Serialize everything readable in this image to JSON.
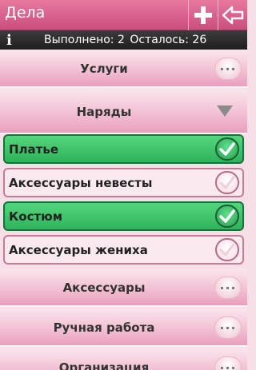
{
  "header": {
    "title": "Дела",
    "add_icon": "plus-icon",
    "back_icon": "back-arrow-icon"
  },
  "status": {
    "info_icon": "info-icon",
    "info_glyph": "i",
    "done_label": "Выполнено: 2",
    "left_label": "Осталось: 26"
  },
  "list": {
    "cat_uslugi": "Услуги",
    "cat_naryady": "Наряды",
    "item_plate": "Платье",
    "item_aks_nevesty": "Аксессуары невесты",
    "item_kostyum": "Костюм",
    "item_aks_zheniha": "Аксессуары жениха",
    "cat_aksessuary": "Аксессуары",
    "cat_ruchnaya": "Ручная работа",
    "cat_organizaciya": "Организация",
    "dots_glyph": "···"
  },
  "colors": {
    "header": "#d9618b",
    "done": "#3cc066",
    "category": "#f2c1d3"
  }
}
